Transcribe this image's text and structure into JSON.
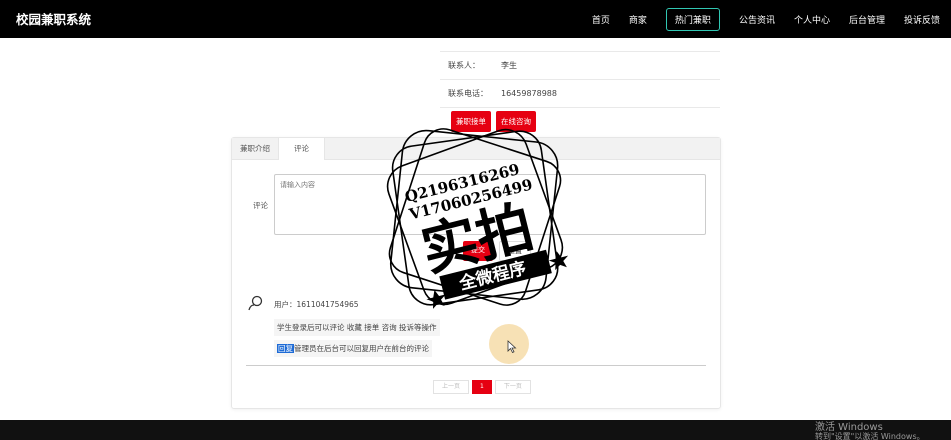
{
  "navbar": {
    "brand": "校园兼职系统",
    "items": [
      {
        "label": "首页",
        "active": false
      },
      {
        "label": "商家",
        "active": false
      },
      {
        "label": "热门兼职",
        "active": true
      },
      {
        "label": "公告资讯",
        "active": false
      },
      {
        "label": "个人中心",
        "active": false
      },
      {
        "label": "后台管理",
        "active": false
      },
      {
        "label": "投诉反馈",
        "active": false
      }
    ]
  },
  "detail": {
    "rows": [
      {
        "label": "联系人：",
        "value": "李生"
      },
      {
        "label": "联系电话：",
        "value": "16459878988"
      }
    ],
    "buttons": {
      "apply": "兼职接单",
      "consult": "在线咨询"
    }
  },
  "tabs": [
    {
      "label": "兼职介绍",
      "active": false
    },
    {
      "label": "评论",
      "active": true
    }
  ],
  "comment_form": {
    "label": "评论",
    "placeholder": "请输入内容",
    "submit": "提交",
    "reset": "重置"
  },
  "comments": [
    {
      "user": "用户：1611041754965",
      "text": "学生登录后可以评论 收藏 接单 咨询 投诉等操作",
      "reply_tag": "回复",
      "reply": "管理员在后台可以回复用户在前台的评论"
    }
  ],
  "pager": {
    "prev": "上一页",
    "current": "1",
    "next": "下一页"
  },
  "watermark": {
    "line1": "Q2196316269",
    "line2": "V17060256499",
    "big": "实拍",
    "ribbon": "全微程序"
  },
  "windows": {
    "activate": "激活 Windows",
    "hint": "转到\"设置\"以激活 Windows。"
  },
  "colors": {
    "navbar_bg": "#000000",
    "accent_red": "#e60012",
    "active_nav_border": "#31c7b3"
  }
}
